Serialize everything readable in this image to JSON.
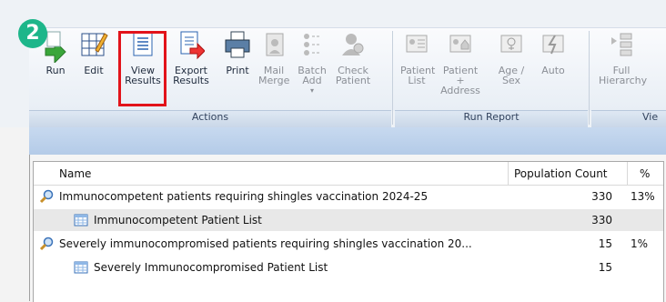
{
  "badge": "2",
  "ribbon": {
    "buttons": [
      {
        "id": "run",
        "label": "Run"
      },
      {
        "id": "edit",
        "label": "Edit"
      },
      {
        "id": "view",
        "label": "View\nResults"
      },
      {
        "id": "export",
        "label": "Export\nResults"
      },
      {
        "id": "print",
        "label": "Print"
      },
      {
        "id": "mail",
        "label": "Mail\nMerge"
      },
      {
        "id": "batch",
        "label": "Batch\nAdd"
      },
      {
        "id": "check",
        "label": "Check\nPatient"
      },
      {
        "id": "plist",
        "label": "Patient\nList"
      },
      {
        "id": "paddr",
        "label": "Patient +\nAddress"
      },
      {
        "id": "agesex",
        "label": "Age /\nSex"
      },
      {
        "id": "auto",
        "label": "Auto"
      },
      {
        "id": "full",
        "label": "Full\nHierarchy"
      }
    ],
    "groups": {
      "actions": "Actions",
      "run_report": "Run Report",
      "view": "Vie"
    }
  },
  "table": {
    "headers": {
      "name": "Name",
      "count": "Population Count",
      "pct": "%"
    },
    "rows": [
      {
        "name": "Immunocompetent patients requiring shingles vaccination 2024-25",
        "count": "330",
        "pct": "13%"
      },
      {
        "name": "Immunocompetent Patient List",
        "count": "330",
        "pct": ""
      },
      {
        "name": "Severely immunocompromised patients requiring shingles vaccination 20...",
        "count": "15",
        "pct": "1%"
      },
      {
        "name": "Severely Immunocompromised Patient List",
        "count": "15",
        "pct": ""
      }
    ]
  }
}
